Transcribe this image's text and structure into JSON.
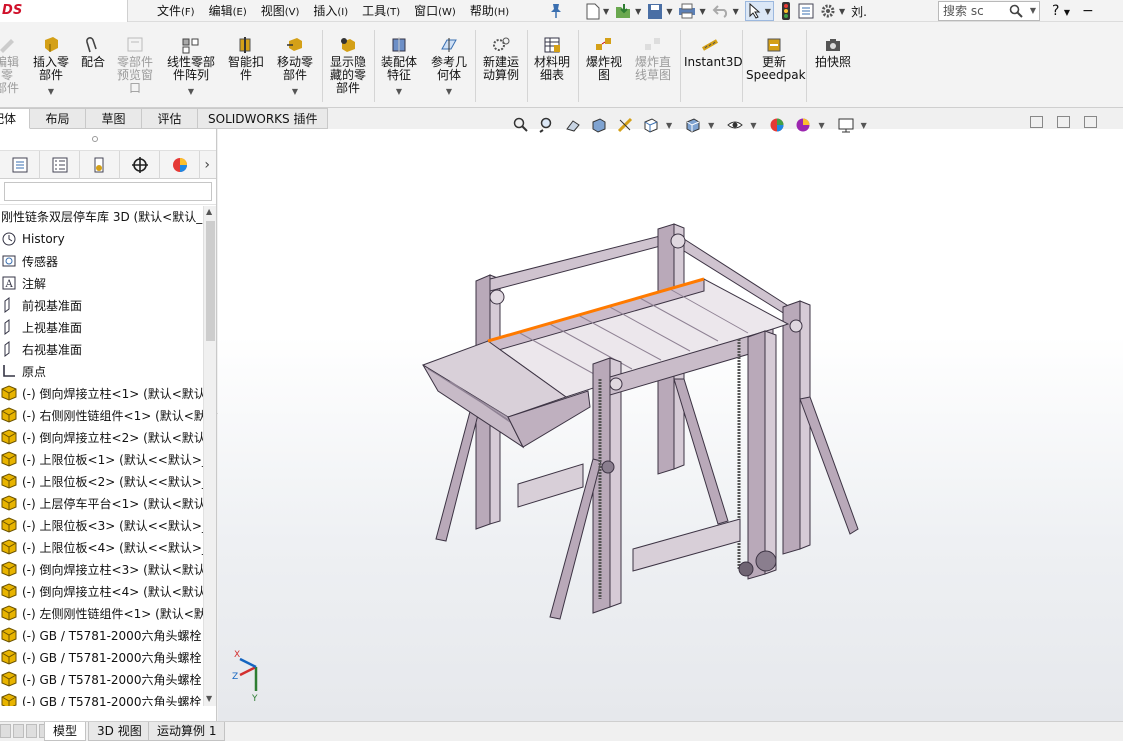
{
  "app": {
    "logo": "DS SOLIDWORKS"
  },
  "menu": [
    {
      "label": "文件",
      "hot": "(F)"
    },
    {
      "label": "编辑",
      "hot": "(E)"
    },
    {
      "label": "视图",
      "hot": "(V)"
    },
    {
      "label": "插入",
      "hot": "(I)"
    },
    {
      "label": "工具",
      "hot": "(T)"
    },
    {
      "label": "窗口",
      "hot": "(W)"
    },
    {
      "label": "帮助",
      "hot": "(H)"
    }
  ],
  "search": {
    "placeholder": "搜索 sc"
  },
  "quick_text": "刘.",
  "ribbon": [
    {
      "label": "编辑零\n部件",
      "disabled": true
    },
    {
      "label": "插入零\n部件",
      "disabled": false
    },
    {
      "label": "配合",
      "disabled": false
    },
    {
      "label": "零部件\n预览窗\n口",
      "disabled": true
    },
    {
      "label": "线性零部\n件阵列",
      "disabled": false
    },
    {
      "label": "智能扣\n件",
      "disabled": false
    },
    {
      "label": "移动零\n部件",
      "disabled": false
    },
    {
      "label": "显示隐\n藏的零\n部件",
      "disabled": false
    },
    {
      "label": "装配体\n特征",
      "disabled": false
    },
    {
      "label": "参考几\n何体",
      "disabled": false
    },
    {
      "label": "新建运\n动算例",
      "disabled": false
    },
    {
      "label": "材料明\n细表",
      "disabled": false
    },
    {
      "label": "爆炸视\n图",
      "disabled": false
    },
    {
      "label": "爆炸直\n线草图",
      "disabled": true
    },
    {
      "label": "Instant3D",
      "disabled": false
    },
    {
      "label": "更新\nSpeedpak",
      "disabled": false
    },
    {
      "label": "拍快照",
      "disabled": false
    }
  ],
  "tabs": [
    "装配体",
    "布局",
    "草图",
    "评估",
    "SOLIDWORKS 插件"
  ],
  "tree": {
    "root": "刚性链条双层停车库 3D (默认<默认_",
    "items": [
      "History",
      "传感器",
      "注解",
      "前视基准面",
      "上视基准面",
      "右视基准面",
      "原点",
      "(-) 倒向焊接立柱<1> (默认<默认_",
      "(-) 右侧刚性链组件<1> (默认<默",
      "(-) 倒向焊接立柱<2> (默认<默认_",
      "(-) 上限位板<1> (默认<<默认>_",
      "(-) 上限位板<2> (默认<<默认>_",
      "(-) 上层停车平台<1> (默认<默认_",
      "(-) 上限位板<3> (默认<<默认>_",
      "(-) 上限位板<4> (默认<<默认>_",
      "(-) 倒向焊接立柱<3> (默认<默认_",
      "(-) 倒向焊接立柱<4> (默认<默认_",
      "(-) 左侧刚性链组件<1> (默认<默",
      "(-) GB / T5781-2000六角头螺栓",
      "(-) GB / T5781-2000六角头螺栓",
      "(-) GB / T5781-2000六角头螺栓",
      "(-) GB / T5781-2000六角头螺栓"
    ]
  },
  "bottom_tabs": [
    "模型",
    "3D 视图",
    "运动算例 1"
  ],
  "triad": {
    "x": "X",
    "y": "Y",
    "z": "Z"
  },
  "colors": {
    "accent": "#d0112b",
    "part_icon": "#e8b400",
    "model": "#b9a9b9",
    "highlight": "#ff7a00"
  }
}
